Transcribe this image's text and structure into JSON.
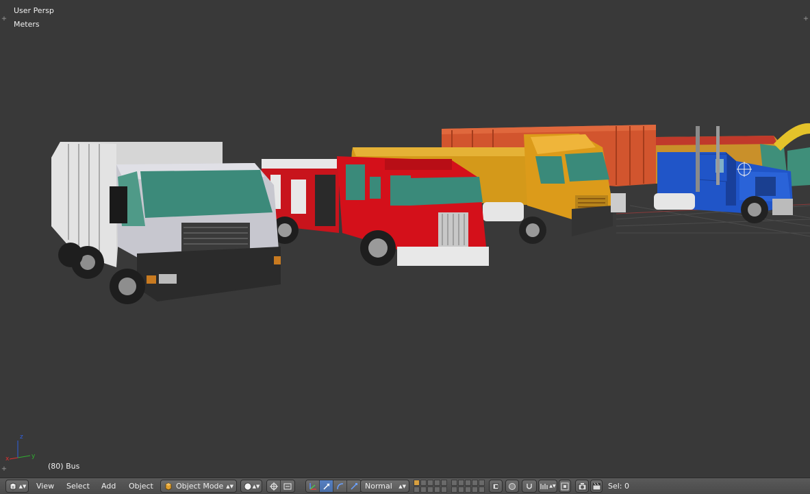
{
  "viewport": {
    "view_name": "User Persp",
    "units": "Meters",
    "object_info": "(80) Bus",
    "axis_labels": {
      "x": "x",
      "y": "y",
      "z": "z"
    },
    "background_color": "#393939"
  },
  "header": {
    "menus": {
      "view": "View",
      "select": "Select",
      "add": "Add",
      "object": "Object"
    },
    "mode": "Object Mode",
    "pivot_pivot": "",
    "orientation": "Normal",
    "selection_info": "Sel: 0",
    "accent_color": "#5680c2"
  },
  "icons": {
    "editor_type": "3d-view-icon",
    "mode": "cube-icon",
    "shading": "solid-sphere-icon",
    "pivot": "pivot-point-icon",
    "manipulator": "manipulator-icon",
    "translate": "translate-arrow-icon",
    "rotate": "rotate-icon",
    "scale": "scale-icon"
  }
}
